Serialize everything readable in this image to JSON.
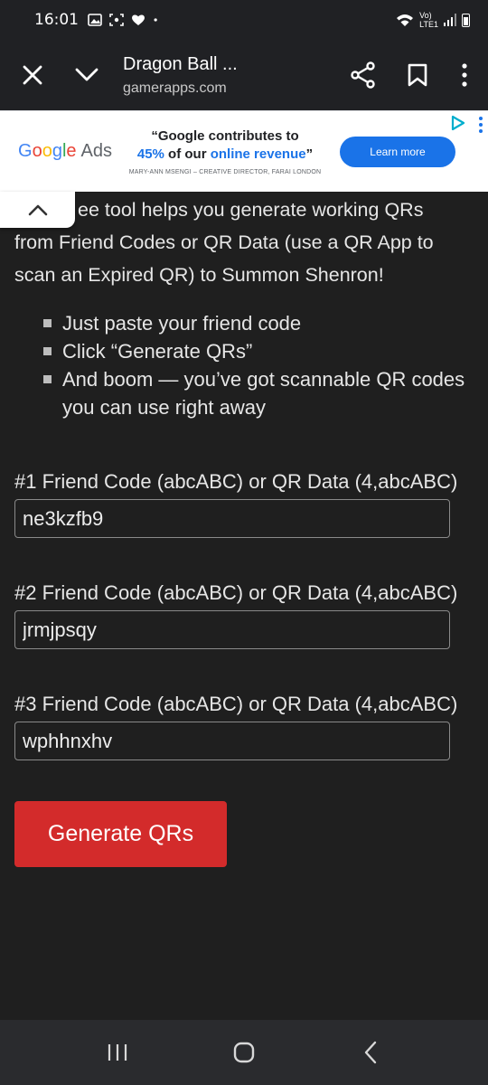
{
  "status_bar": {
    "time": "16:01",
    "network_vo": "Vo)",
    "network_lte": "LTE1",
    "wifi_level": "6"
  },
  "toolbar": {
    "title": "Dragon Ball ...",
    "url": "gamerapps.com"
  },
  "ad": {
    "brand_google": "Google",
    "brand_ads": "Ads",
    "headline_line1": "“Google contributes to",
    "headline_pct": "45%",
    "headline_mid": " of our ",
    "headline_blue": "online revenue",
    "headline_end": "”",
    "credit": "MARY-ANN MSENGI – CREATIVE DIRECTOR, FARAI LONDON",
    "cta": "Learn more"
  },
  "content": {
    "intro_line1": "ee tool helps you generate working QRs",
    "intro_rest": "from Friend Codes or QR Data (use a QR App to scan an Expired QR) to Summon Shenron!",
    "bullets": [
      "Just paste your friend code",
      "Click “Generate QRs”",
      "And boom — you’ve got scannable QR codes you can use right away"
    ],
    "fields": [
      {
        "label": "#1 Friend Code (abcABC) or QR Data (4,abcABC)",
        "value": "ne3kzfb9"
      },
      {
        "label": "#2 Friend Code (abcABC) or QR Data (4,abcABC)",
        "value": "jrmjpsqy"
      },
      {
        "label": "#3 Friend Code (abcABC) or QR Data (4,abcABC)",
        "value": "wphhnxhv"
      }
    ],
    "generate_label": "Generate QRs"
  },
  "colors": {
    "background": "#1f1f1f",
    "button_red": "#d32b2b",
    "toolbar": "#202124",
    "google_blue": "#1a73e8"
  },
  "icons": [
    "close-icon",
    "chevron-down-icon",
    "share-icon",
    "bookmark-icon",
    "more-vert-icon",
    "chevron-up-icon",
    "recents-icon",
    "home-icon",
    "back-icon"
  ]
}
